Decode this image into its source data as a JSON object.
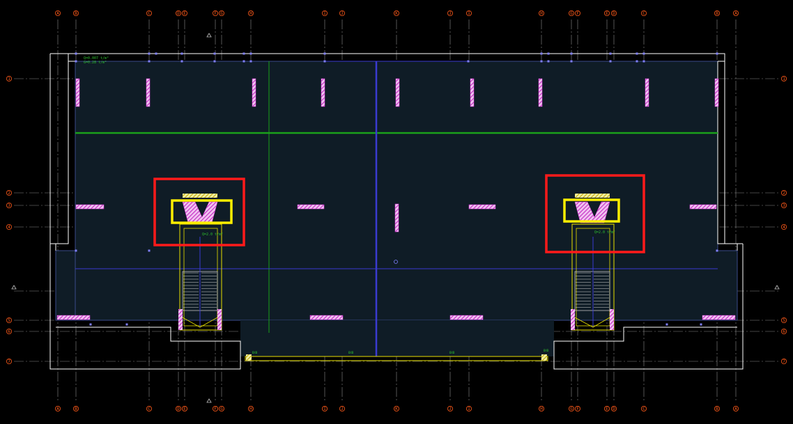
{
  "drawing": {
    "column_grid": [
      {
        "label": "A"
      },
      {
        "label": "B"
      },
      {
        "label": "C"
      },
      {
        "label": "D"
      },
      {
        "label": "E"
      },
      {
        "label": "F"
      },
      {
        "label": "G"
      },
      {
        "label": "H"
      },
      {
        "label": "I"
      },
      {
        "label": "J"
      },
      {
        "label": "K"
      },
      {
        "label": "J"
      },
      {
        "label": "I"
      },
      {
        "label": "H"
      },
      {
        "label": "G"
      },
      {
        "label": "F"
      },
      {
        "label": "E"
      },
      {
        "label": "D"
      },
      {
        "label": "C"
      },
      {
        "label": "B"
      },
      {
        "label": "A"
      }
    ],
    "row_grid": [
      {
        "label": "1"
      },
      {
        "label": "2"
      },
      {
        "label": "3"
      },
      {
        "label": "4"
      },
      {
        "label": "5"
      },
      {
        "label": "6"
      },
      {
        "label": "7"
      }
    ],
    "notes": {
      "top_left_note_line1": "Q=0.007 t/m²",
      "top_left_note_line2": "G=0.28 t/m²",
      "left_stair_note": "Q=2.0 t/m²",
      "right_stair_note": "Q=2.0 t/m²",
      "bottom_label": "B",
      "bottom_small_1": "BXB",
      "bottom_small_2": "BXB",
      "bottom_small_3": "BXB",
      "bottom_small_4": "BXB"
    },
    "colors": {
      "background": "#000000",
      "slab_fill": "#0f1c26",
      "grid_line": "#8a8a8a",
      "axis_label": "#ff5a1a",
      "wall_hatch": "#e040e0",
      "beam_green": "#1aa01a",
      "beam_blue": "#3a3ad0",
      "slab_outline": "#ffffff",
      "stair_yellow": "#e8e000",
      "highlight_red": "#ff1a1a",
      "highlight_yellow": "#ffee00"
    },
    "icons": {
      "axis_bubble": "circle-axis-bubble-icon",
      "section_marker": "triangle-section-marker-icon"
    }
  }
}
